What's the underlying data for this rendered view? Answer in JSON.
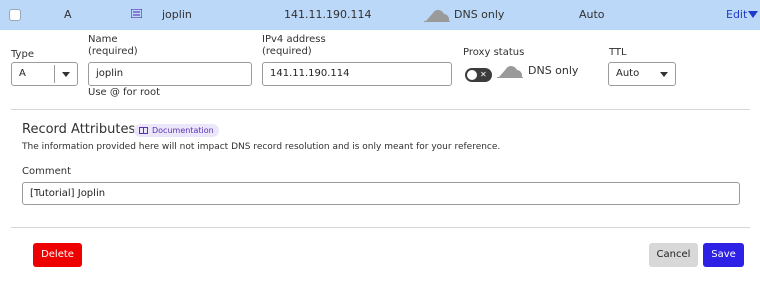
{
  "record_row": {
    "type": "A",
    "name": "joplin",
    "content": "141.11.190.114",
    "proxy_status": "DNS only",
    "ttl": "Auto",
    "edit_label": "Edit"
  },
  "form": {
    "type": {
      "label": "Type",
      "value": "A"
    },
    "name": {
      "label_line1": "Name",
      "label_line2": "(required)",
      "value": "joplin",
      "hint": "Use @ for root"
    },
    "ipv4": {
      "label_line1": "IPv4 address",
      "label_line2": "(required)",
      "value": "141.11.190.114"
    },
    "proxy": {
      "label": "Proxy status",
      "value": "DNS only",
      "enabled": false
    },
    "ttl": {
      "label": "TTL",
      "value": "Auto"
    }
  },
  "record_attributes": {
    "title": "Record Attributes",
    "doc_link": "Documentation",
    "description": "The information provided here will not impact DNS record resolution and is only meant for your reference.",
    "comment_label": "Comment",
    "comment_value": "[Tutorial] Joplin"
  },
  "actions": {
    "delete": "Delete",
    "cancel": "Cancel",
    "save": "Save"
  },
  "colors": {
    "row_highlight": "#bcd8f8",
    "delete": "#ee0000",
    "save": "#2f20e6",
    "link": "#1f3bcc",
    "badge_bg": "#ece6fb",
    "badge_text": "#5a32b6"
  },
  "icons": {
    "type_icon": "list-icon",
    "proxy_icon": "cloud-icon",
    "edit_icon": "caret-down-icon",
    "doc_icon": "book-icon",
    "select_icon": "chevron-down-icon"
  }
}
